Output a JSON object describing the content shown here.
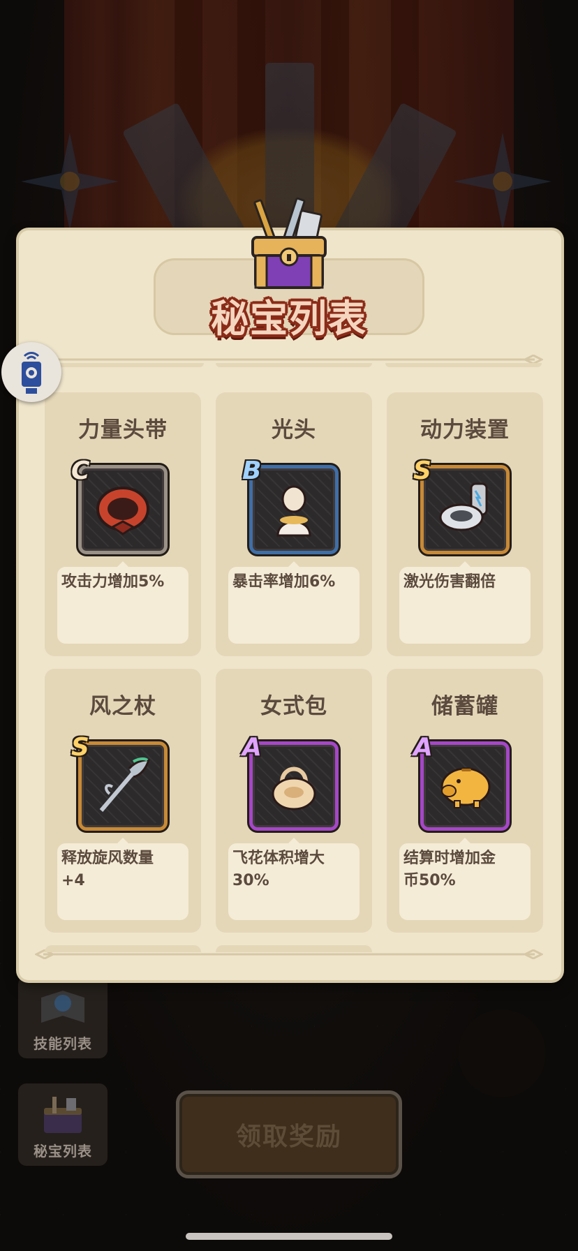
{
  "modal": {
    "title": "秘宝列表",
    "items": [
      {
        "name": "力量头带",
        "grade": "C",
        "desc": "攻击力增加5%",
        "icon": "red-headband-icon"
      },
      {
        "name": "光头",
        "grade": "B",
        "desc": "暴击率增加6%",
        "icon": "bald-head-icon"
      },
      {
        "name": "动力装置",
        "grade": "S",
        "desc": "激光伤害翻倍",
        "icon": "toilet-engine-icon"
      },
      {
        "name": "风之杖",
        "grade": "S",
        "desc": "释放旋风数量\n+4",
        "icon": "wind-staff-icon"
      },
      {
        "name": "女式包",
        "grade": "A",
        "desc": "飞花体积增大\n30%",
        "icon": "handbag-icon"
      },
      {
        "name": "储蓄罐",
        "grade": "A",
        "desc": "结算时增加金\n币50%",
        "icon": "piggy-bank-icon"
      }
    ]
  },
  "background": {
    "skill_list_label": "技能列表",
    "treasure_list_label": "秘宝列表",
    "claim_button_label": "领取奖励"
  },
  "colors": {
    "panel": "#efe5cb",
    "card": "#e4d7b7",
    "title_outline": "#8b2b18",
    "grade_B": "#3f6fa8",
    "grade_S": "#c88a36",
    "grade_A": "#a547c7",
    "grade_C": "#9a9187"
  }
}
